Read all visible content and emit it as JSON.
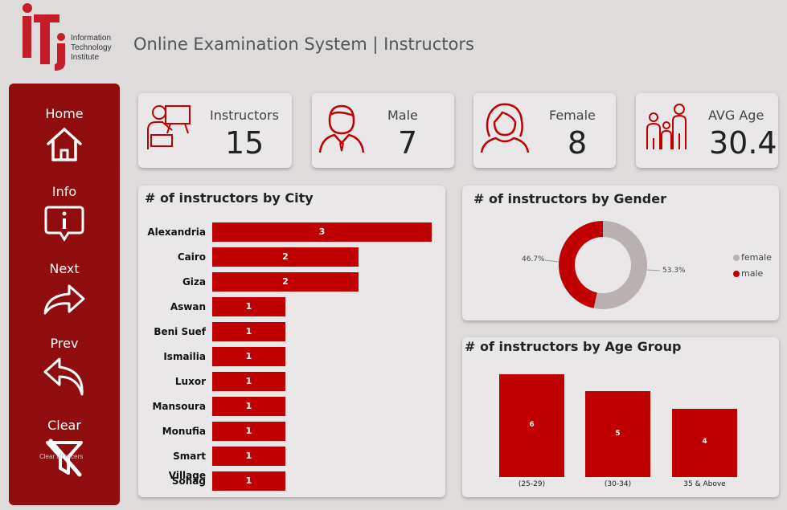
{
  "brand": {
    "logo_letters": "iTi",
    "line1": "Information",
    "line2": "Technology",
    "line3": "Institute",
    "color": "#c41e2a"
  },
  "header": {
    "title": "Online Examination System | Instructors"
  },
  "sidebar": {
    "bg_color": "#8f0d0d",
    "items": [
      {
        "label": "Home",
        "icon": "home-icon"
      },
      {
        "label": "Info",
        "icon": "info-icon"
      },
      {
        "label": "Next",
        "icon": "forward-arrow-icon"
      },
      {
        "label": "Prev",
        "icon": "reply-arrow-icon"
      },
      {
        "label": "Clear",
        "icon": "clear-filter-icon",
        "sub": "Clear all slicers"
      }
    ]
  },
  "kpis": [
    {
      "label": "Instructors",
      "value": "15",
      "icon": "teacher-icon"
    },
    {
      "label": "Male",
      "value": "7",
      "icon": "male-icon"
    },
    {
      "label": "Female",
      "value": "8",
      "icon": "female-icon"
    },
    {
      "label": "AVG Age",
      "value": "30.4",
      "icon": "family-icon"
    }
  ],
  "chart_data": [
    {
      "type": "bar",
      "orientation": "horizontal",
      "title": "# of instructors by City",
      "categories": [
        "Alexandria",
        "Cairo",
        "Giza",
        "Aswan",
        "Beni Suef",
        "Ismailia",
        "Luxor",
        "Mansoura",
        "Monufia",
        "Smart Village",
        "Sohag"
      ],
      "values": [
        3,
        2,
        2,
        1,
        1,
        1,
        1,
        1,
        1,
        1,
        1
      ],
      "color": "#c00000"
    },
    {
      "type": "pie",
      "variant": "donut",
      "title": "# of instructors by Gender",
      "categories": [
        "female",
        "male"
      ],
      "values": [
        8,
        7
      ],
      "labels": [
        "53.3%",
        "46.7%"
      ],
      "colors": [
        "#b9b0b0",
        "#c00000"
      ],
      "legend": "right"
    },
    {
      "type": "bar",
      "title": "# of instructors by Age Group",
      "categories": [
        "(25-29)",
        "(30-34)",
        "35 & Above"
      ],
      "values": [
        6,
        5,
        4
      ],
      "color": "#c00000"
    }
  ]
}
